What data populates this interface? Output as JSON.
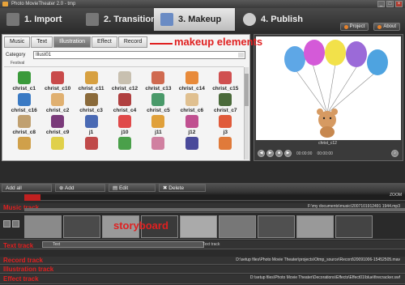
{
  "window": {
    "title": "Photo MovieTheater 2.0 - tmp"
  },
  "steps": [
    {
      "label": "1. Import"
    },
    {
      "label": "2. Transition"
    },
    {
      "label": "3. Makeup"
    },
    {
      "label": "4. Publish"
    }
  ],
  "topbuttons": {
    "project": "Project",
    "about": "About"
  },
  "tabs": [
    "Music",
    "Text",
    "Illustration",
    "Effect",
    "Record"
  ],
  "category": {
    "label": "Category",
    "value": "Illust01"
  },
  "grid_header": "Festival",
  "items": [
    {
      "label": "christ_c1",
      "color": "#3a9a3a"
    },
    {
      "label": "christ_c10",
      "color": "#c94a4a"
    },
    {
      "label": "christ_c11",
      "color": "#d7a040"
    },
    {
      "label": "christ_c12",
      "color": "#c8c0b0"
    },
    {
      "label": "christ_c13",
      "color": "#d06a50"
    },
    {
      "label": "christ_c14",
      "color": "#e88a3a"
    },
    {
      "label": "christ_c15",
      "color": "#d05050"
    },
    {
      "label": "christ_c16",
      "color": "#3a7ac4"
    },
    {
      "label": "christ_c2",
      "color": "#e0b070"
    },
    {
      "label": "christ_c3",
      "color": "#8a6a3a"
    },
    {
      "label": "christ_c4",
      "color": "#b04040"
    },
    {
      "label": "christ_c5",
      "color": "#4a9a6a"
    },
    {
      "label": "christ_c6",
      "color": "#e0c090"
    },
    {
      "label": "christ_c7",
      "color": "#4a6a3a"
    },
    {
      "label": "christ_c8",
      "color": "#c0a070"
    },
    {
      "label": "christ_c9",
      "color": "#7a3a7a"
    },
    {
      "label": "j1",
      "color": "#4a6ab4"
    },
    {
      "label": "j10",
      "color": "#e04a4a"
    },
    {
      "label": "j11",
      "color": "#e0a03a"
    },
    {
      "label": "j12",
      "color": "#c05090"
    },
    {
      "label": "j3",
      "color": "#e05a3a"
    },
    {
      "label": "",
      "color": "#d0a04a"
    },
    {
      "label": "",
      "color": "#e0d04a"
    },
    {
      "label": "",
      "color": "#c04a4a"
    },
    {
      "label": "",
      "color": "#4aa04a"
    },
    {
      "label": "",
      "color": "#d080a0"
    },
    {
      "label": "",
      "color": "#4a4a9a"
    },
    {
      "label": "",
      "color": "#e07a3a"
    }
  ],
  "preview": {
    "clip_name": "christ_c12",
    "time_current": "00:00:00",
    "time_total": "00:00:00"
  },
  "annotations": {
    "makeup": "makeup elements",
    "storyboard": "storyboard"
  },
  "actions": {
    "add_all": "Add all",
    "add": "Add",
    "edit": "Edit",
    "delete": "Delete"
  },
  "zoom_label": "ZOOM",
  "tracks": {
    "music": {
      "label": "Music track",
      "path": "F:\\my documents\\music\\2007101912491 1944.mp3"
    },
    "text": {
      "label": "Text track",
      "clip": "Text",
      "center": "Text track"
    },
    "record": {
      "label": "Record track",
      "path": "D:\\setup files\\Photo Movie Theater\\projects\\Otmp_source\\Record\\20091006-15452505.mav"
    },
    "illustration": {
      "label": "Illustration track"
    },
    "effect": {
      "label": "Effect track",
      "path": "D:\\setup files\\Photo Movie Theater\\Decorations\\Effects\\Effect01\\blue\\firecracker.swf"
    }
  },
  "colors": {
    "accent_red": "#e02020",
    "active_tab": "#6d6d6d"
  }
}
